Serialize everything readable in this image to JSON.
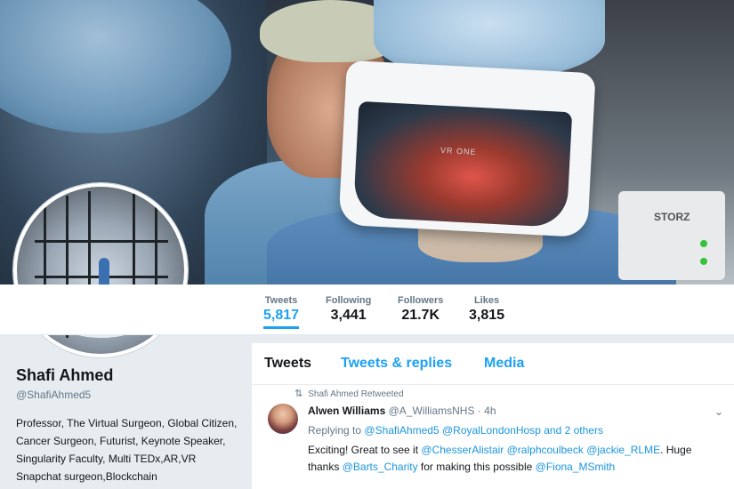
{
  "banner": {
    "headset_label": "VR ONE",
    "device_label": "STORZ"
  },
  "profile": {
    "name": "Shafi Ahmed",
    "handle": "@ShafiAhmed5",
    "bio": "Professor, The Virtual Surgeon, Global Citizen, Cancer Surgeon, Futurist, Keynote Speaker, Singularity Faculty, Multi TEDx,AR,VR Snapchat surgeon,Blockchain"
  },
  "stats": [
    {
      "label": "Tweets",
      "value": "5,817"
    },
    {
      "label": "Following",
      "value": "3,441"
    },
    {
      "label": "Followers",
      "value": "21.7K"
    },
    {
      "label": "Likes",
      "value": "3,815"
    }
  ],
  "tabs": [
    {
      "label": "Tweets"
    },
    {
      "label": "Tweets & replies"
    },
    {
      "label": "Media"
    }
  ],
  "tweet": {
    "retweet_context": "Shafi Ahmed Retweeted",
    "author_name": "Alwen Williams",
    "author_handle": "@A_WilliamsNHS",
    "separator": "·",
    "time": "4h",
    "replying_prefix": "Replying to",
    "reply_mentions": [
      "@ShafiAhmed5",
      "@RoyalLondonHosp"
    ],
    "reply_suffix": "and 2 others",
    "text_parts": {
      "p1": "Exciting! Great to see it",
      "m1": "@ChesserAlistair",
      "m2": "@ralphcoulbeck",
      "m3": "@jackie_RLME",
      "p2": ". Huge thanks",
      "m4": "@Barts_Charity",
      "p3": "for making this possible",
      "m5": "@Fiona_MSmith"
    }
  },
  "colors": {
    "accent": "#1da1f2",
    "link": "#1b95e0",
    "muted": "#657786",
    "background": "#e6ecf0"
  }
}
